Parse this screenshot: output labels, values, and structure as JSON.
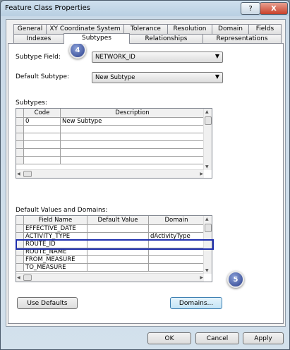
{
  "window": {
    "title": "Feature Class Properties",
    "help": "?",
    "close": "X"
  },
  "tabs_row1": [
    "General",
    "XY Coordinate System",
    "Tolerance",
    "Resolution",
    "Domain",
    "Fields"
  ],
  "tabs_row2": [
    "Indexes",
    "Subtypes",
    "Relationships",
    "Representations"
  ],
  "subtype_field": {
    "label": "Subtype Field:",
    "value": "NETWORK_ID"
  },
  "default_subtype": {
    "label": "Default Subtype:",
    "value": "New Subtype"
  },
  "subtypes": {
    "label": "Subtypes:",
    "headers": [
      "Code",
      "Description"
    ],
    "rows": [
      [
        "0",
        "New Subtype"
      ]
    ]
  },
  "defaults": {
    "label": "Default Values and Domains:",
    "headers": [
      "Field Name",
      "Default Value",
      "Domain"
    ],
    "rows": [
      [
        "EFFECTIVE_DATE",
        "",
        ""
      ],
      [
        "ACTIVITY_TYPE",
        "",
        "dActivityType"
      ],
      [
        "ROUTE_ID",
        "",
        ""
      ],
      [
        "ROUTE_NAME",
        "",
        ""
      ],
      [
        "FROM_MEASURE",
        "",
        ""
      ],
      [
        "TO_MEASURE",
        "",
        ""
      ]
    ]
  },
  "buttons": {
    "use_defaults": "Use Defaults",
    "domains": "Domains...",
    "ok": "OK",
    "cancel": "Cancel",
    "apply": "Apply"
  },
  "callouts": {
    "a": "4",
    "b": "5"
  },
  "colors": {
    "highlight": "#1f2fae",
    "callout": "#2b3f8c"
  }
}
